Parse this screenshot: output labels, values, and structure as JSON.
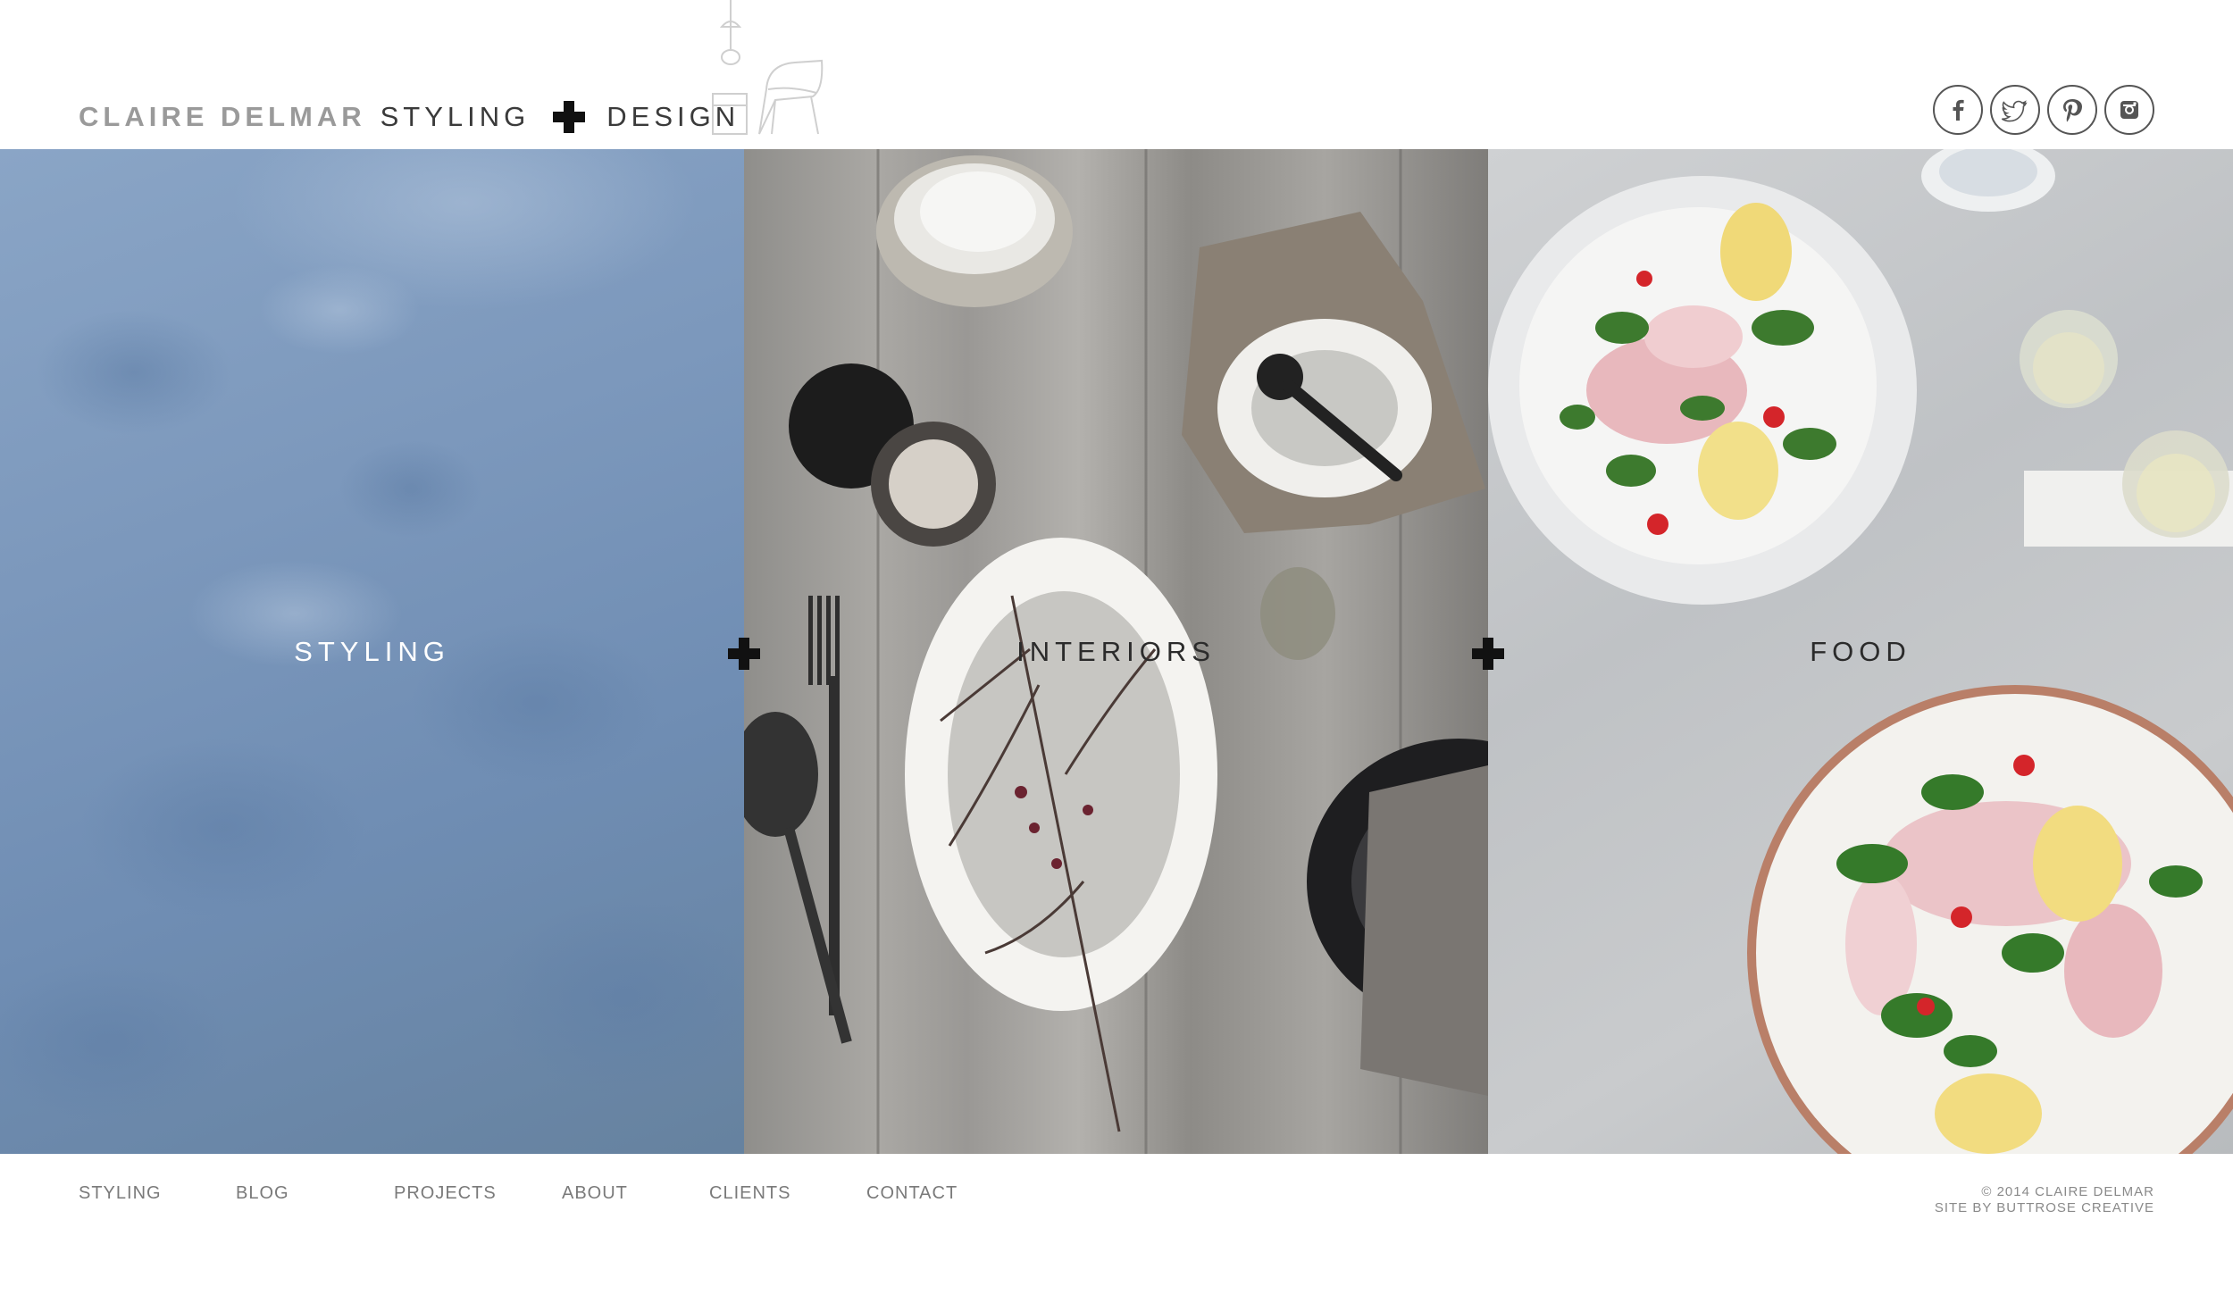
{
  "brand": {
    "name": "CLAIRE DELMAR",
    "styling": "STYLING",
    "design": "DESIGN"
  },
  "social": [
    {
      "icon": "facebook-icon",
      "glyph": "f"
    },
    {
      "icon": "twitter-icon",
      "glyph": "t"
    },
    {
      "icon": "pinterest-icon",
      "glyph": "p"
    },
    {
      "icon": "instagram-icon",
      "glyph": "i"
    }
  ],
  "panels": [
    {
      "label": "STYLING"
    },
    {
      "label": "INTERIORS"
    },
    {
      "label": "FOOD"
    }
  ],
  "footer": {
    "nav": [
      "STYLING",
      "BLOG",
      "PROJECTS",
      "ABOUT",
      "CLIENTS",
      "CONTACT"
    ],
    "copyright": "© 2014 CLAIRE DELMAR",
    "credit": "SITE BY BUTTROSE CREATIVE"
  },
  "colors": {
    "brand_grey": "#9a9a9a",
    "brand_dark": "#3a3a3a",
    "nav_grey": "#7a7a7a",
    "styling_blue": "#7c98bc"
  }
}
